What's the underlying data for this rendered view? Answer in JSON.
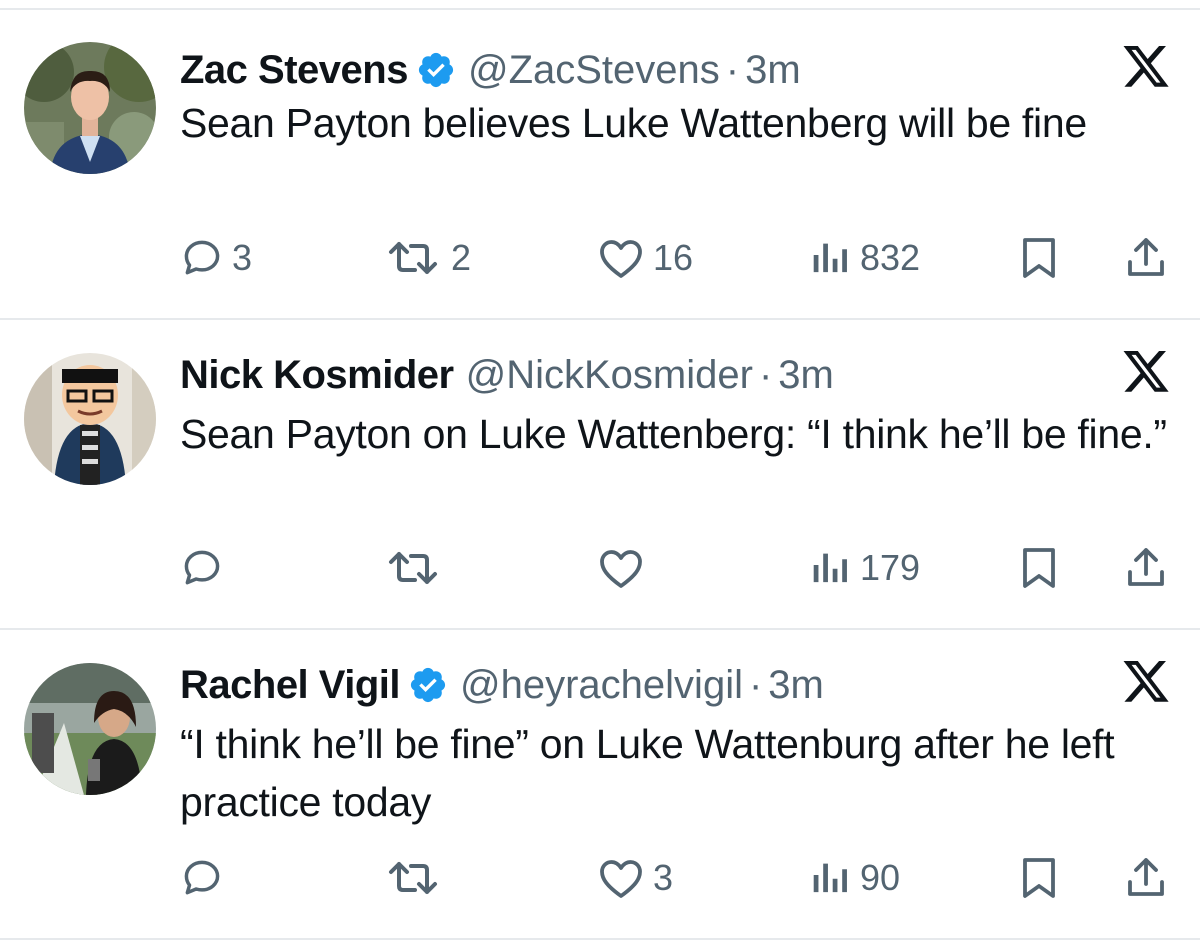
{
  "tweets": [
    {
      "name": "Zac Stevens",
      "verified": true,
      "handle": "@ZacStevens",
      "separator": "·",
      "time": "3m",
      "text": "Sean Payton believes Luke Wattenberg will be fine",
      "replies": "3",
      "retweets": "2",
      "likes": "16",
      "views": "832"
    },
    {
      "name": "Nick Kosmider",
      "verified": false,
      "handle": "@NickKosmider",
      "separator": "·",
      "time": "3m",
      "text": "Sean Payton on Luke Wattenberg: “I think he’ll be fine.”",
      "replies": "",
      "retweets": "",
      "likes": "",
      "views": "179"
    },
    {
      "name": "Rachel Vigil",
      "verified": true,
      "handle": "@heyrachelvigil",
      "separator": "·",
      "time": "3m",
      "text": "“I think he’ll be fine” on Luke Wattenburg after he left practice today",
      "replies": "",
      "retweets": "",
      "likes": "3",
      "views": "90"
    }
  ],
  "colors": {
    "text": "#0f1419",
    "secondary": "#536471",
    "verified": "#1d9bf0",
    "divider": "#e6e9ec"
  },
  "icons": [
    "reply-icon",
    "retweet-icon",
    "like-icon",
    "views-icon",
    "bookmark-icon",
    "share-icon",
    "x-logo-icon",
    "verified-badge-icon"
  ]
}
